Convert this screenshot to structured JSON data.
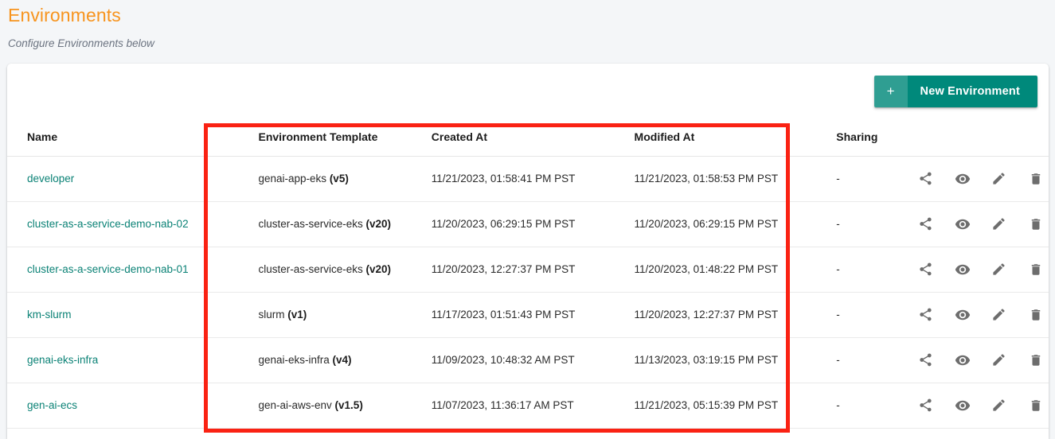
{
  "header": {
    "title": "Environments",
    "subtitle": "Configure Environments below"
  },
  "toolbar": {
    "new_environment_plus": "+",
    "new_environment_label": "New Environment"
  },
  "colors": {
    "title_orange": "#f7941e",
    "link_teal": "#0b8276",
    "button_dark_teal": "#00897b",
    "button_light_teal": "#2f9e92",
    "annotation_red": "#fa2213",
    "page_background": "#f4f6f8",
    "card_background": "#ffffff"
  },
  "table": {
    "columns": [
      {
        "key": "name",
        "label": "Name"
      },
      {
        "key": "template",
        "label": "Environment Template"
      },
      {
        "key": "created_at",
        "label": "Created At"
      },
      {
        "key": "modified_at",
        "label": "Modified At"
      },
      {
        "key": "sharing",
        "label": "Sharing"
      },
      {
        "key": "actions",
        "label": ""
      }
    ],
    "rows": [
      {
        "name": "developer",
        "template_name": "genai-app-eks",
        "template_version": "(v5)",
        "created_at": "11/21/2023, 01:58:41 PM PST",
        "modified_at": "11/21/2023, 01:58:53 PM PST",
        "sharing": "-"
      },
      {
        "name": "cluster-as-a-service-demo-nab-02",
        "template_name": "cluster-as-service-eks",
        "template_version": "(v20)",
        "created_at": "11/20/2023, 06:29:15 PM PST",
        "modified_at": "11/20/2023, 06:29:15 PM PST",
        "sharing": "-"
      },
      {
        "name": "cluster-as-a-service-demo-nab-01",
        "template_name": "cluster-as-service-eks",
        "template_version": "(v20)",
        "created_at": "11/20/2023, 12:27:37 PM PST",
        "modified_at": "11/20/2023, 01:48:22 PM PST",
        "sharing": "-"
      },
      {
        "name": "km-slurm",
        "template_name": "slurm",
        "template_version": "(v1)",
        "created_at": "11/17/2023, 01:51:43 PM PST",
        "modified_at": "11/20/2023, 12:27:37 PM PST",
        "sharing": "-"
      },
      {
        "name": "genai-eks-infra",
        "template_name": "genai-eks-infra",
        "template_version": "(v4)",
        "created_at": "11/09/2023, 10:48:32 AM PST",
        "modified_at": "11/13/2023, 03:19:15 PM PST",
        "sharing": "-"
      },
      {
        "name": "gen-ai-ecs",
        "template_name": "gen-ai-aws-env",
        "template_version": "(v1.5)",
        "created_at": "11/07/2023, 11:36:17 AM PST",
        "modified_at": "11/21/2023, 05:15:39 PM PST",
        "sharing": "-"
      }
    ],
    "row_actions": [
      {
        "name": "share-icon",
        "label": "Share"
      },
      {
        "name": "eye-icon",
        "label": "View"
      },
      {
        "name": "pencil-icon",
        "label": "Edit"
      },
      {
        "name": "trash-icon",
        "label": "Delete"
      }
    ]
  },
  "annotation": {
    "shape": "rectangle",
    "color": "#fa2213"
  }
}
